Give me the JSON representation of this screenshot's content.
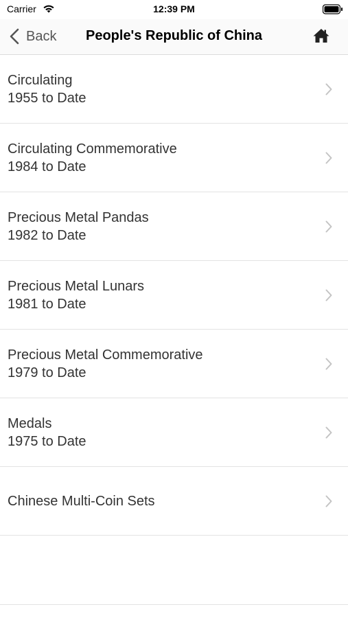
{
  "status_bar": {
    "carrier": "Carrier",
    "time": "12:39 PM"
  },
  "nav": {
    "back_label": "Back",
    "title": "People's Republic of China"
  },
  "rows": [
    {
      "title": "Circulating",
      "subtitle": "1955 to Date"
    },
    {
      "title": "Circulating Commemorative",
      "subtitle": "1984 to Date"
    },
    {
      "title": "Precious Metal Pandas",
      "subtitle": "1982 to Date"
    },
    {
      "title": "Precious Metal Lunars",
      "subtitle": "1981 to Date"
    },
    {
      "title": "Precious Metal Commemorative",
      "subtitle": "1979 to Date"
    },
    {
      "title": "Medals",
      "subtitle": "1975 to Date"
    },
    {
      "title": "Chinese Multi-Coin Sets",
      "subtitle": ""
    }
  ],
  "icons": {
    "back": "chevron-left-icon",
    "home": "home-icon",
    "row_disclosure": "chevron-right-icon",
    "wifi": "wifi-icon",
    "battery": "battery-icon"
  },
  "colors": {
    "chevron": "#c4c4c4",
    "separator": "#e3e3e3",
    "text": "#333333"
  }
}
